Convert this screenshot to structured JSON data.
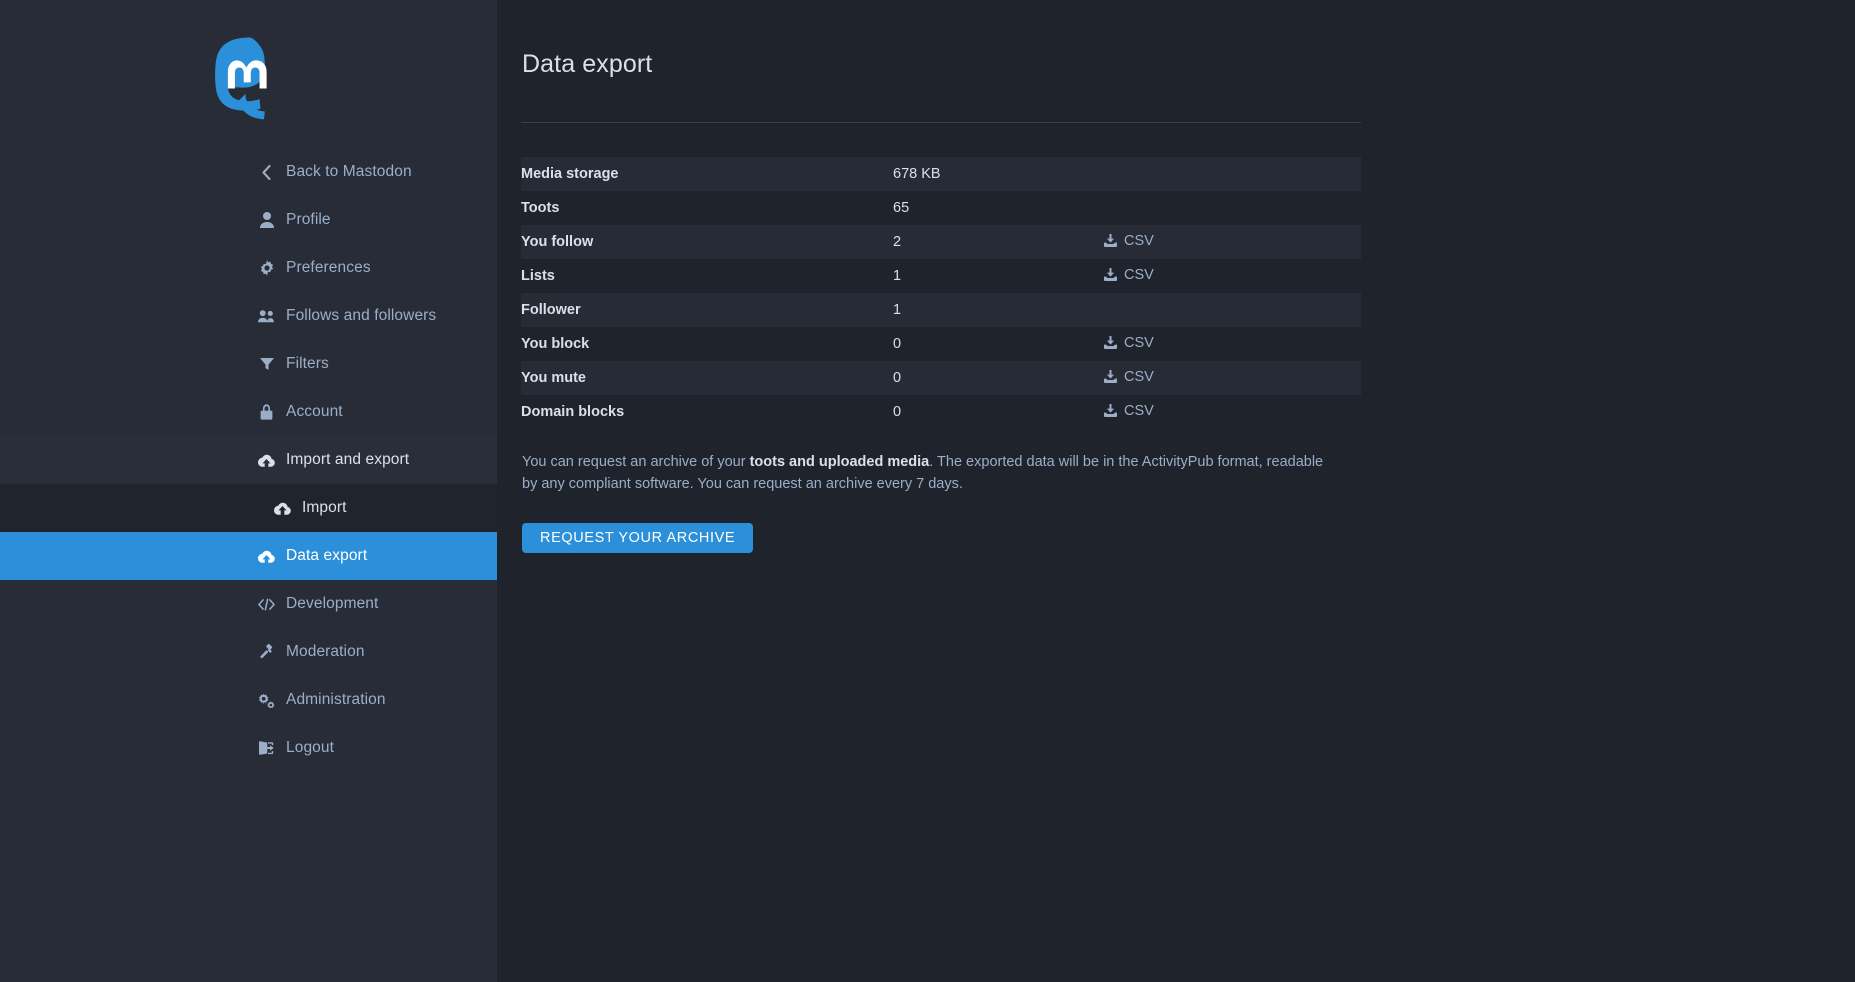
{
  "brand": {
    "logo_icon": "mastodon-logo",
    "accent_color": "#2b90d9",
    "sidebar_bg": "#282c37",
    "page_bg": "#1f232b",
    "text_color": "#d9e1e8",
    "muted_text_color": "#9baec8"
  },
  "sidebar": {
    "items": [
      {
        "label": "Back to Mastodon",
        "icon": "chevron-left-icon",
        "state": "normal"
      },
      {
        "label": "Profile",
        "icon": "user-icon",
        "state": "normal"
      },
      {
        "label": "Preferences",
        "icon": "gear-icon",
        "state": "normal"
      },
      {
        "label": "Follows and followers",
        "icon": "users-icon",
        "state": "normal"
      },
      {
        "label": "Filters",
        "icon": "filter-icon",
        "state": "normal"
      },
      {
        "label": "Account",
        "icon": "lock-icon",
        "state": "normal"
      },
      {
        "label": "Import and export",
        "icon": "cloud-download-icon",
        "state": "parent-open"
      },
      {
        "label": "Import",
        "icon": "cloud-upload-icon",
        "state": "sub"
      },
      {
        "label": "Data export",
        "icon": "cloud-download-icon",
        "state": "active"
      },
      {
        "label": "Development",
        "icon": "code-icon",
        "state": "normal"
      },
      {
        "label": "Moderation",
        "icon": "gavel-icon",
        "state": "normal"
      },
      {
        "label": "Administration",
        "icon": "cogs-icon",
        "state": "normal"
      },
      {
        "label": "Logout",
        "icon": "sign-out-icon",
        "state": "normal"
      }
    ]
  },
  "main": {
    "page_title": "Data export",
    "table": {
      "rows": [
        {
          "label": "Media storage",
          "value": "678 KB",
          "action": ""
        },
        {
          "label": "Toots",
          "value": "65",
          "action": ""
        },
        {
          "label": "You follow",
          "value": "2",
          "action": "CSV"
        },
        {
          "label": "Lists",
          "value": "1",
          "action": "CSV"
        },
        {
          "label": "Follower",
          "value": "1",
          "action": ""
        },
        {
          "label": "You block",
          "value": "0",
          "action": "CSV"
        },
        {
          "label": "You mute",
          "value": "0",
          "action": "CSV"
        },
        {
          "label": "Domain blocks",
          "value": "0",
          "action": "CSV"
        }
      ],
      "download_icon": "download-icon"
    },
    "hint": {
      "part1": "You can request an archive of your ",
      "emphasis": "toots and uploaded media",
      "part2": ". The exported data will be in the ActivityPub format, readable by any compliant software. You can request an archive every 7 days."
    },
    "request_button_label": "REQUEST YOUR ARCHIVE"
  }
}
